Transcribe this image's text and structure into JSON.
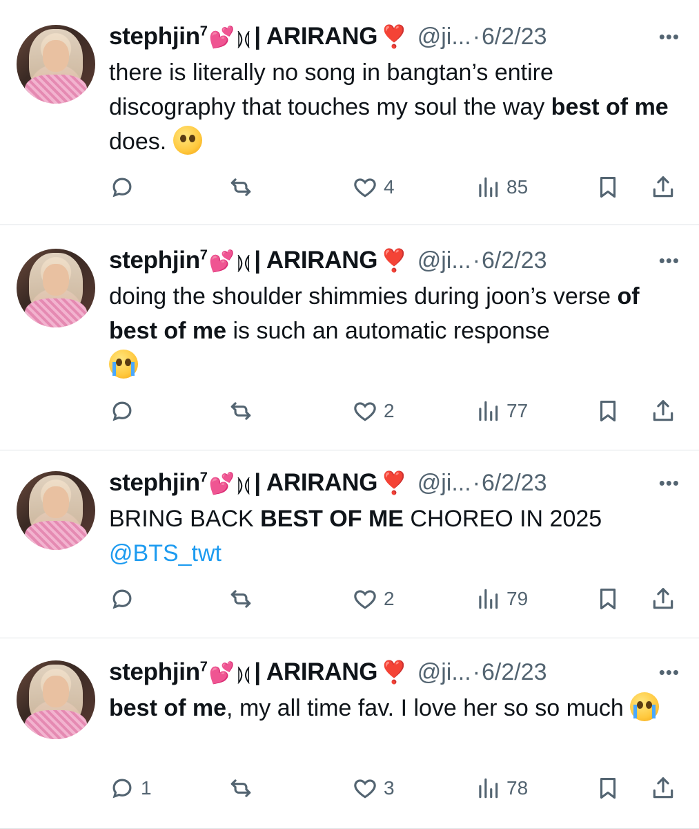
{
  "tweets": [
    {
      "author": {
        "name": "stephjin",
        "sup": "7",
        "heart_emoji": "💕",
        "symbol": "⟭⟬",
        "suffix": "| ARIRANG",
        "red_emoji": "❣️"
      },
      "handle": "@ji...",
      "separator": "·",
      "date": "6/2/23",
      "text_html": "there is literally no song in bangtan’s entire discography that touches my soul the way <b>best of me</b> does. ",
      "text_emoji": "pleading",
      "stats": {
        "replies": "",
        "likes": "4",
        "views": "85"
      }
    },
    {
      "author": {
        "name": "stephjin",
        "sup": "7",
        "heart_emoji": "💕",
        "symbol": "⟭⟬",
        "suffix": "| ARIRANG",
        "red_emoji": "❣️"
      },
      "handle": "@ji...",
      "separator": "·",
      "date": "6/2/23",
      "text_html": "doing the shoulder shimmies during joon’s verse <b>of best of me</b> is such an automatic response<br>",
      "text_emoji": "crying",
      "stats": {
        "replies": "",
        "likes": "2",
        "views": "77"
      }
    },
    {
      "author": {
        "name": "stephjin",
        "sup": "7",
        "heart_emoji": "💕",
        "symbol": "⟭⟬",
        "suffix": "| ARIRANG",
        "red_emoji": "❣️"
      },
      "handle": "@ji...",
      "separator": "·",
      "date": "6/2/23",
      "text_html": "BRING BACK <b>BEST OF ME</b> CHOREO IN 2025<br><span class=\"mention\">@BTS_twt</span>",
      "text_emoji": "",
      "stats": {
        "replies": "",
        "likes": "2",
        "views": "79"
      }
    },
    {
      "author": {
        "name": "stephjin",
        "sup": "7",
        "heart_emoji": "💕",
        "symbol": "⟭⟬",
        "suffix": "| ARIRANG",
        "red_emoji": "❣️"
      },
      "handle": "@ji...",
      "separator": "·",
      "date": "6/2/23",
      "text_html": "<b>best of me</b>, my all time fav. I love her so so much ",
      "text_emoji": "crying",
      "stats": {
        "replies": "1",
        "likes": "3",
        "views": "78"
      }
    }
  ],
  "icons": {
    "more": "more-dots-icon",
    "reply": "reply-bubble-icon",
    "retweet": "retweet-icon",
    "like": "heart-outline-icon",
    "views": "views-bars-icon",
    "bookmark": "bookmark-icon",
    "share": "share-upload-icon"
  },
  "colors": {
    "text": "#0f1419",
    "muted": "#536471",
    "link": "#1d9bf0",
    "divider": "#dfe3e6"
  }
}
